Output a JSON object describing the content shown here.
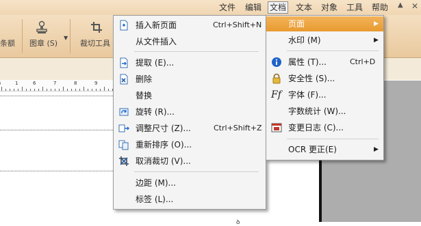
{
  "menubar": {
    "items": [
      "文件",
      "编辑",
      "文档",
      "文本",
      "对象",
      "工具",
      "帮助"
    ],
    "active_index": 2
  },
  "ribbon": {
    "partial_label": "条额",
    "seal_label": "图章 (S)",
    "crop_label": "裁切工具"
  },
  "ruler": {
    "numbers": [
      "1",
      "5",
      "6",
      "7",
      "8",
      "9"
    ]
  },
  "doc_menu": {
    "items": [
      {
        "label": "插入新页面",
        "shortcut": "Ctrl+Shift+N",
        "icon": "insert-page-icon"
      },
      {
        "label": "从文件插入",
        "shortcut": "",
        "icon": ""
      },
      {
        "label": "提取 (E)...",
        "shortcut": "",
        "icon": "extract-icon"
      },
      {
        "label": "删除",
        "shortcut": "",
        "icon": "delete-page-icon"
      },
      {
        "label": "替换",
        "shortcut": "",
        "icon": ""
      },
      {
        "label": "旋转 (R)...",
        "shortcut": "",
        "icon": "rotate-icon"
      },
      {
        "label": "调整尺寸 (Z)...",
        "shortcut": "Ctrl+Shift+Z",
        "icon": "resize-icon"
      },
      {
        "label": "重新排序 (O)...",
        "shortcut": "",
        "icon": "reorder-icon"
      },
      {
        "label": "取消裁切 (V)...",
        "shortcut": "",
        "icon": "uncrop-icon"
      },
      {
        "label": "边距 (M)...",
        "shortcut": "",
        "icon": ""
      },
      {
        "label": "标签 (L)...",
        "shortcut": "",
        "icon": ""
      }
    ]
  },
  "sub_menu": {
    "items": [
      {
        "label": "页面",
        "shortcut": "",
        "icon": "",
        "submenu": true,
        "highlighted": true
      },
      {
        "label": "水印 (M)",
        "shortcut": "",
        "icon": "",
        "submenu": true
      },
      {
        "label": "属性 (T)...",
        "shortcut": "Ctrl+D",
        "icon": "info-icon"
      },
      {
        "label": "安全性 (S)...",
        "shortcut": "",
        "icon": "lock-icon"
      },
      {
        "label": "字体 (F)...",
        "shortcut": "",
        "icon": "font-icon"
      },
      {
        "label": "字数统计 (W)...",
        "shortcut": "",
        "icon": ""
      },
      {
        "label": "变更日志 (C)...",
        "shortcut": "",
        "icon": "changelog-icon"
      },
      {
        "label": "OCR 更正(E)",
        "shortcut": "",
        "icon": "",
        "submenu": true
      }
    ]
  },
  "colors": {
    "ribbon": "#efd4ad",
    "highlight": "#ee9f38",
    "menu_bg": "#f4f4f4"
  }
}
